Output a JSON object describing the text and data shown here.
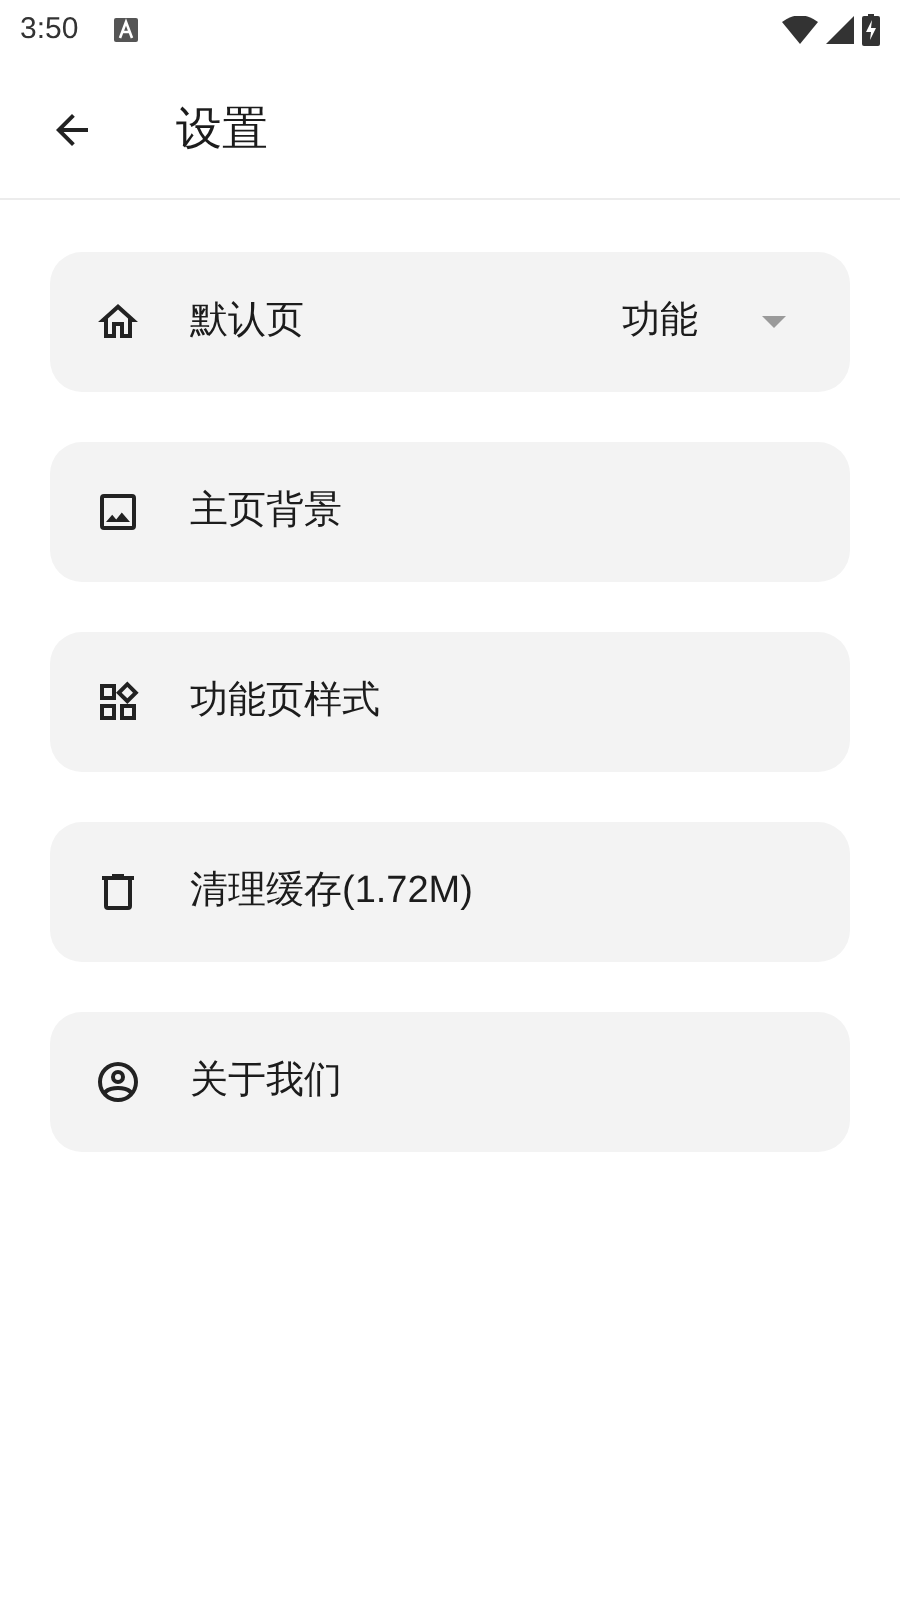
{
  "status_bar": {
    "time": "3:50"
  },
  "app_bar": {
    "title": "设置"
  },
  "items": [
    {
      "kind": "select",
      "label": "默认页",
      "value": "功能"
    },
    {
      "kind": "link",
      "label": "主页背景"
    },
    {
      "kind": "link",
      "label": "功能页样式"
    },
    {
      "kind": "link",
      "label": "清理缓存(1.72M)"
    },
    {
      "kind": "link",
      "label": "关于我们"
    }
  ]
}
